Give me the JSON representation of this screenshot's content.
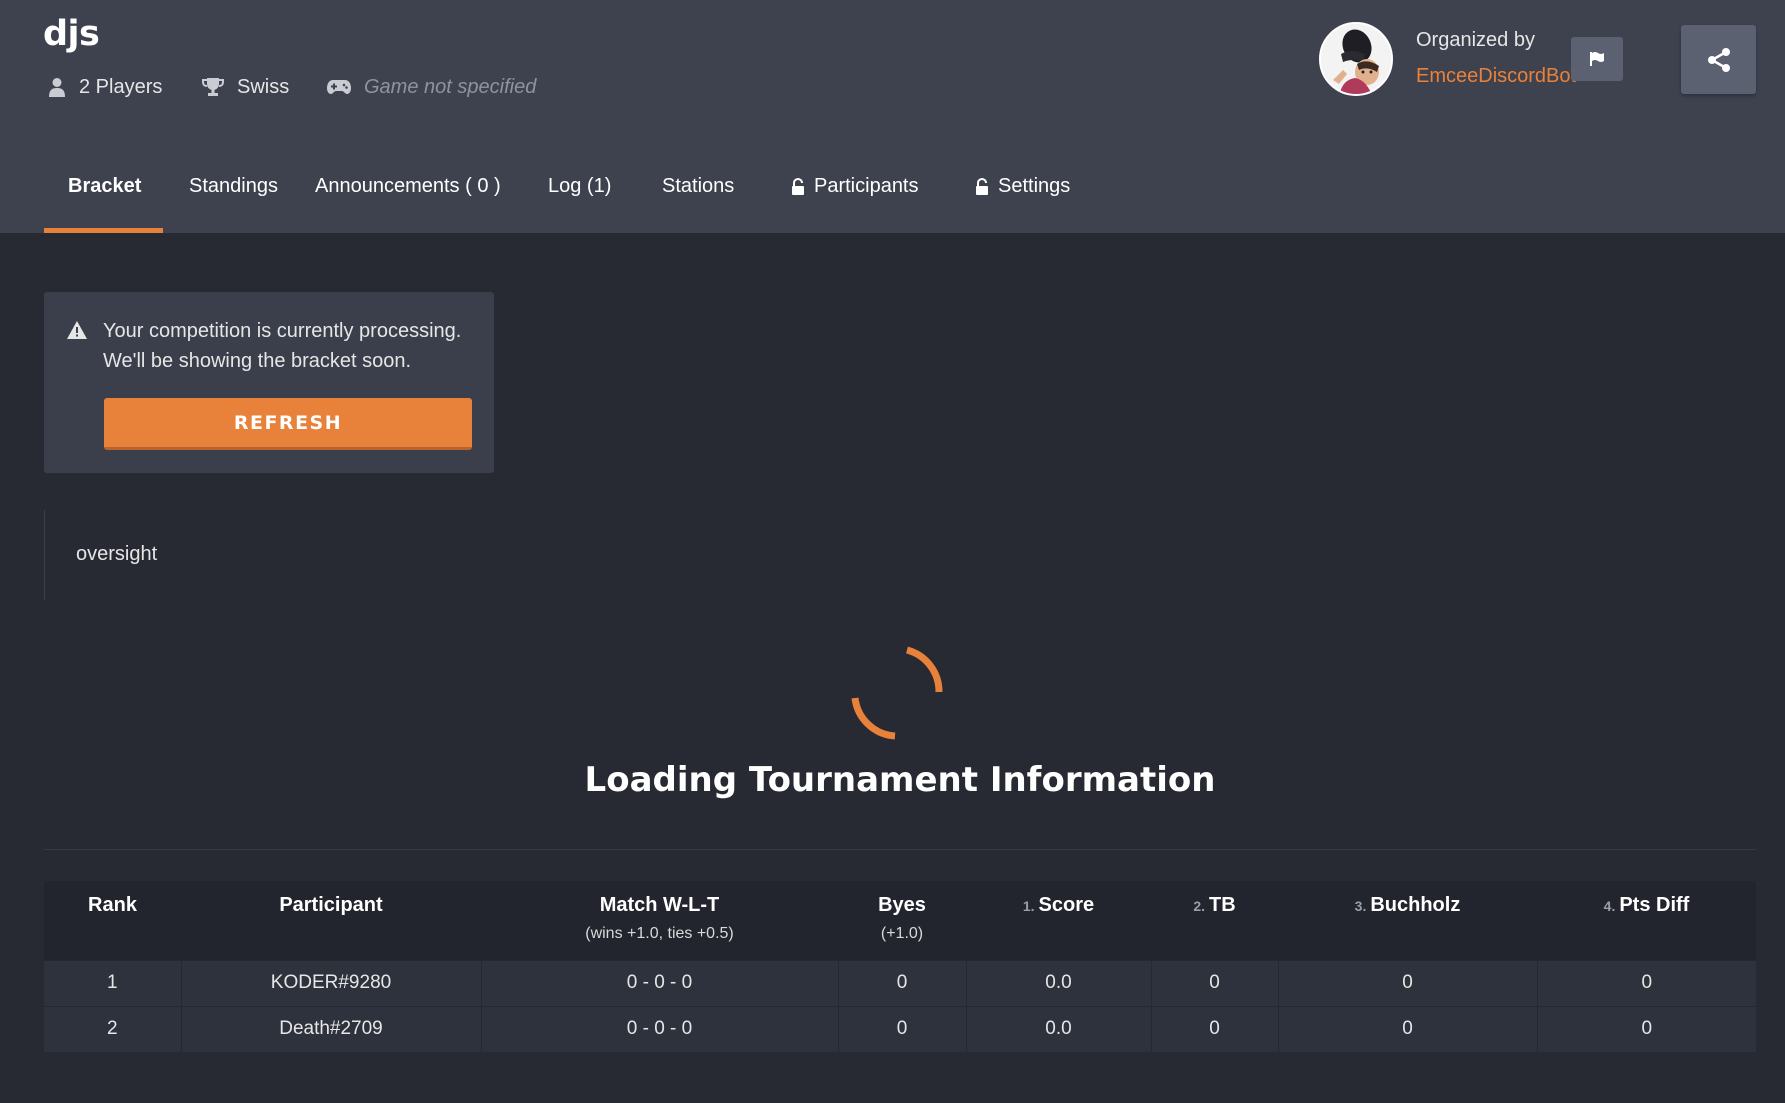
{
  "header": {
    "title": "djs",
    "players": "2 Players",
    "format": "Swiss",
    "game": "Game not specified",
    "organized_by_label": "Organized by",
    "organizer": "EmceeDiscordBot",
    "accent_color": "#e8813a"
  },
  "tabs": [
    {
      "label": "Bracket",
      "active": true
    },
    {
      "label": "Standings"
    },
    {
      "label": "Announcements ( 0 )"
    },
    {
      "label": "Log (1)"
    },
    {
      "label": "Stations"
    },
    {
      "label": "Participants",
      "icon": "unlock-icon"
    },
    {
      "label": "Settings",
      "icon": "unlock-icon"
    }
  ],
  "notice": {
    "message_line1": "Your competition is currently processing.",
    "message_line2": "We'll be showing the bracket soon.",
    "refresh_label": "REFRESH"
  },
  "description": "oversight",
  "loading": "Loading Tournament Information",
  "standings": {
    "columns": [
      {
        "label": "Rank"
      },
      {
        "label": "Participant"
      },
      {
        "label": "Match W-L-T",
        "sub": "(wins +1.0, ties +0.5)"
      },
      {
        "label": "Byes",
        "sub": "(+1.0)"
      },
      {
        "num": "1.",
        "label": "Score"
      },
      {
        "num": "2.",
        "label": "TB"
      },
      {
        "num": "3.",
        "label": "Buchholz"
      },
      {
        "num": "4.",
        "label": "Pts Diff"
      }
    ],
    "rows": [
      [
        "1",
        "KODER#9280",
        "0 - 0 - 0",
        "0",
        "0.0",
        "0",
        "0",
        "0"
      ],
      [
        "2",
        "Death#2709",
        "0 - 0 - 0",
        "0",
        "0.0",
        "0",
        "0",
        "0"
      ]
    ]
  }
}
